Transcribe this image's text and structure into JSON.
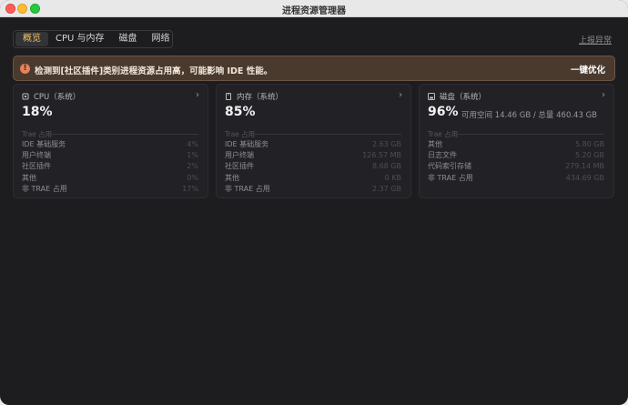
{
  "window": {
    "title": "进程资源管理器"
  },
  "tabs": [
    {
      "label": "概览"
    },
    {
      "label": "CPU 与内存"
    },
    {
      "label": "磁盘"
    },
    {
      "label": "网络"
    }
  ],
  "header": {
    "report_label": "上报异常"
  },
  "banner": {
    "text": "检测到[社区插件]类别进程资源占用高，可能影响 IDE 性能。",
    "action": "一键优化"
  },
  "cards": {
    "cpu": {
      "title": "CPU（系统）",
      "value": "18%",
      "group_title": "Trae 占用",
      "rows": [
        {
          "k": "IDE 基础服务",
          "v": "4%"
        },
        {
          "k": "用户终端",
          "v": "1%"
        },
        {
          "k": "社区插件",
          "v": "2%"
        },
        {
          "k": "其他",
          "v": "0%"
        },
        {
          "k": "非 TRAE 占用",
          "v": "17%"
        }
      ]
    },
    "memory": {
      "title": "内存（系统）",
      "value": "85%",
      "group_title": "Trae 占用",
      "rows": [
        {
          "k": "IDE 基础服务",
          "v": "2.63 GB"
        },
        {
          "k": "用户终端",
          "v": "126.57 MB"
        },
        {
          "k": "社区插件",
          "v": "8.68 GB"
        },
        {
          "k": "其他",
          "v": "0 KB"
        },
        {
          "k": "非 TRAE 占用",
          "v": "2.37 GB"
        }
      ]
    },
    "disk": {
      "title": "磁盘（系统）",
      "value": "96%",
      "sub": "可用空间 14.46 GB / 总量 460.43 GB",
      "group_title": "Trae 占用",
      "rows": [
        {
          "k": "其他",
          "v": "5.80 GB"
        },
        {
          "k": "日志文件",
          "v": "5.20 GB"
        },
        {
          "k": "代码索引存储",
          "v": "279.14 MB"
        },
        {
          "k": "非 TRAE 占用",
          "v": "434.69 GB"
        }
      ]
    }
  },
  "colors": {
    "accent": "#f0c45c",
    "banner_bg": "#4a3a2e",
    "warn": "#e8815a"
  }
}
